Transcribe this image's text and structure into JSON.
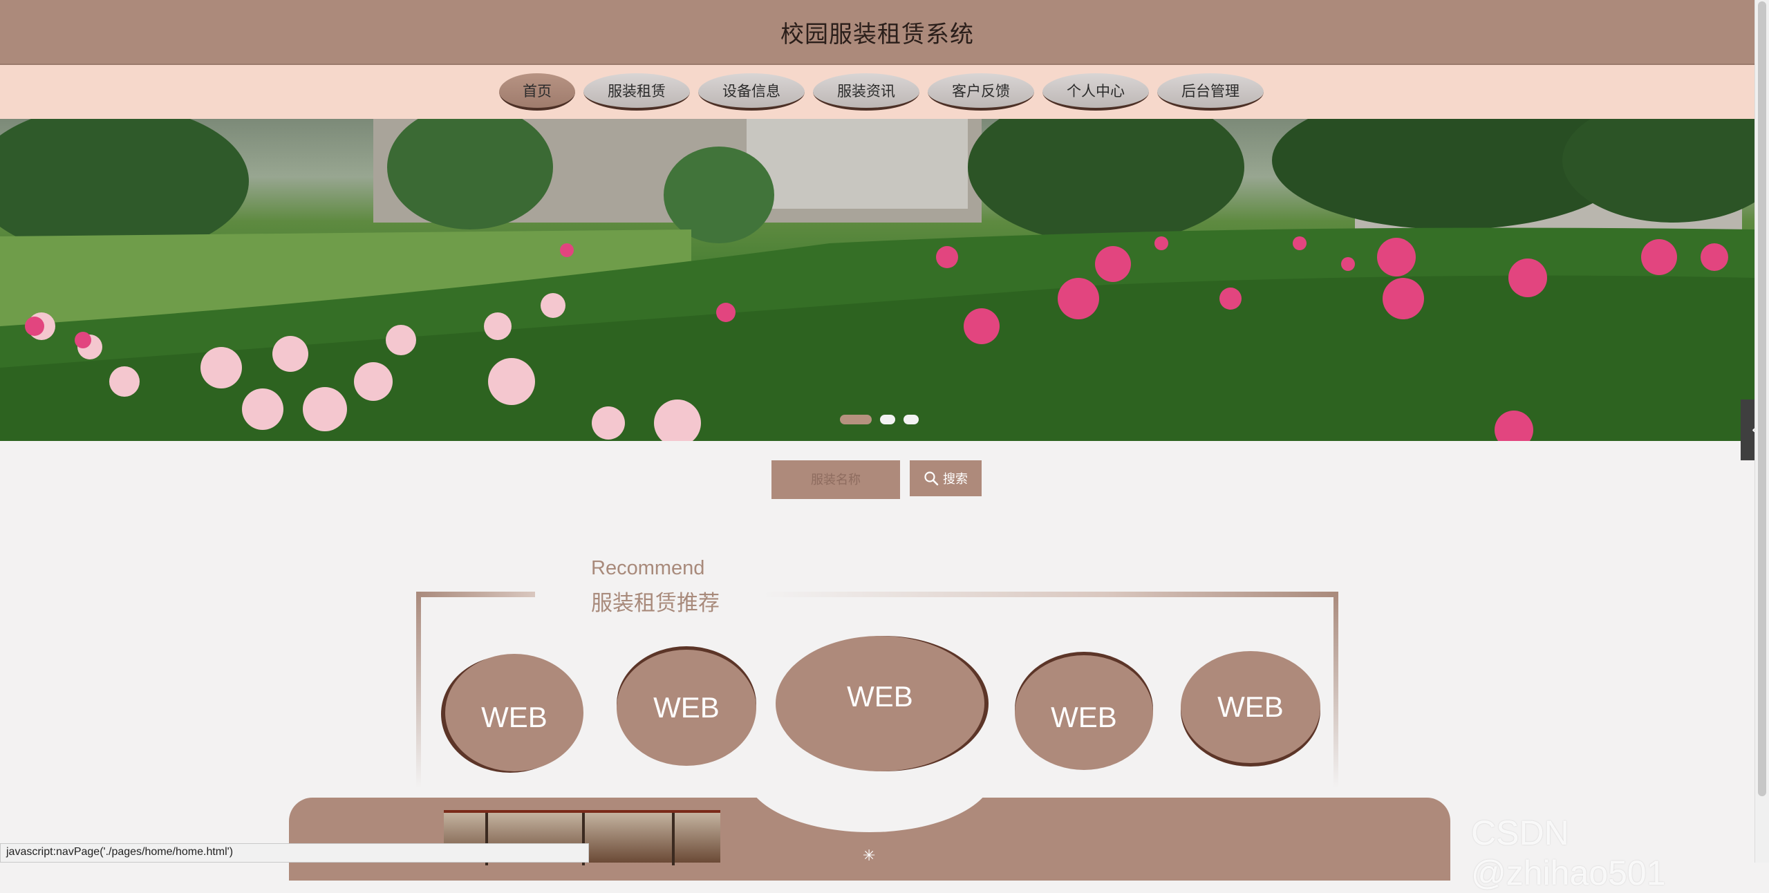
{
  "header": {
    "title": "校园服装租赁系统"
  },
  "nav": {
    "items": [
      {
        "label": "首页",
        "active": true
      },
      {
        "label": "服装租赁",
        "active": false
      },
      {
        "label": "设备信息",
        "active": false
      },
      {
        "label": "服装资讯",
        "active": false
      },
      {
        "label": "客户反馈",
        "active": false
      },
      {
        "label": "个人中心",
        "active": false
      },
      {
        "label": "后台管理",
        "active": false
      }
    ]
  },
  "banner": {
    "slide_count": 3,
    "active_slide": 1,
    "side_toggle_icon": "chevron-left-icon",
    "side_toggle_glyph": "‹"
  },
  "search": {
    "placeholder": "服装名称",
    "button_label": "搜索",
    "button_icon": "search-icon"
  },
  "recommend": {
    "title_en": "Recommend",
    "title_cn": "服装租赁推荐",
    "cards": [
      {
        "label": "WEB"
      },
      {
        "label": "WEB"
      },
      {
        "label": "WEB"
      },
      {
        "label": "WEB"
      },
      {
        "label": "WEB"
      }
    ]
  },
  "bottom": {
    "loader_glyph": "✳"
  },
  "status_bar": {
    "text": "javascript:navPage('./pages/home/home.html')"
  },
  "watermark": {
    "text": "CSDN @zhihao501"
  },
  "colors": {
    "accent": "#ae8a7b",
    "nav_bg": "#f6d8cb",
    "header_bg": "#ac8a7b",
    "page_bg": "#f3f2f2"
  }
}
